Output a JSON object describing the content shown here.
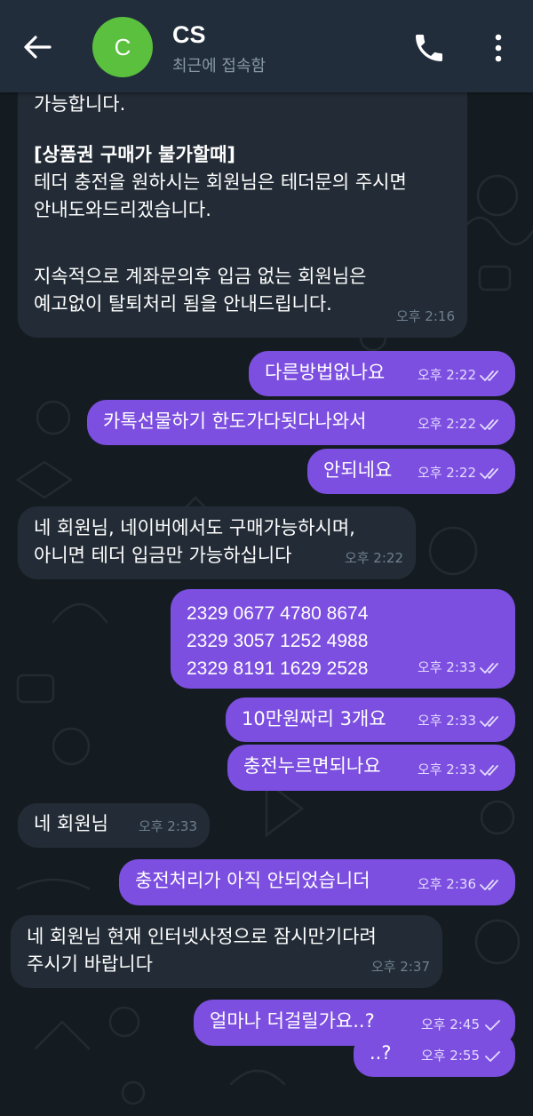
{
  "header": {
    "back_icon": "arrow-left-icon",
    "avatar_letter": "C",
    "avatar_color": "#5ac03e",
    "title": "CS",
    "status": "최근에 접속함",
    "call_icon": "phone-icon",
    "menu_icon": "more-vertical-icon"
  },
  "colors": {
    "incoming_bubble": "#232c36",
    "outgoing_bubble": "#7c4fe0",
    "background": "#151c21",
    "header": "#212d3b"
  },
  "messages": [
    {
      "direction": "in",
      "lines_normal_1": "가능합니다.",
      "heading": "[상품권 구매가 불가할때]",
      "lines_normal_2": "테더 충전을 원하시는 회원님은 테더문의 주시면\n안내도와드리겠습니다.",
      "lines_normal_3": "지속적으로 계좌문의후 입금 없는 회원님은\n예고없이 탈퇴처리 됨을 안내드립니다.",
      "time": "오후 2:16"
    },
    {
      "direction": "out",
      "text": "다른방법없나요",
      "time": "오후 2:22",
      "read": true
    },
    {
      "direction": "out",
      "text": "카톡선물하기 한도가다됫다나와서",
      "time": "오후 2:22",
      "read": true
    },
    {
      "direction": "out",
      "text": "안되네요",
      "time": "오후 2:22",
      "read": true
    },
    {
      "direction": "in",
      "text": "네 회원님, 네이버에서도 구매가능하시며,\n아니면 테더 입금만 가능하십니다",
      "time": "오후 2:22"
    },
    {
      "direction": "out",
      "text": "2329 0677 4780 8674\n2329 3057 1252 4988\n2329 8191 1629 2528",
      "time": "오후 2:33",
      "read": true
    },
    {
      "direction": "out",
      "text": "10만원짜리 3개요",
      "time": "오후 2:33",
      "read": true
    },
    {
      "direction": "out",
      "text": "충전누르면되나요",
      "time": "오후 2:33",
      "read": true
    },
    {
      "direction": "in",
      "text": "네 회원님",
      "time": "오후 2:33"
    },
    {
      "direction": "out",
      "text": "충전처리가 아직 안되었습니더",
      "time": "오후 2:36",
      "read": true
    },
    {
      "direction": "in",
      "text": "네 회원님 현재 인터넷사정으로 잠시만기다려\n주시기 바랍니다",
      "time": "오후 2:37"
    },
    {
      "direction": "out",
      "text": "얼마나 더걸릴가요..?",
      "time": "오후 2:45",
      "read": false
    },
    {
      "direction": "out",
      "text": "..?",
      "time": "오후 2:55",
      "read": false
    }
  ]
}
